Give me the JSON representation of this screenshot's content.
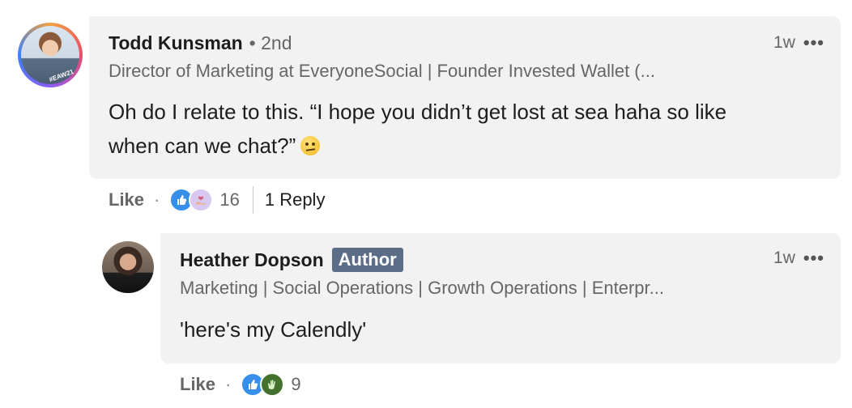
{
  "comment": {
    "author_name": "Todd Kunsman",
    "connection_degree": "• 2nd",
    "headline": "Director of Marketing at EveryoneSocial | Founder Invested Wallet (...",
    "time": "1w",
    "more_icon": "•••",
    "avatar_tag": "#EAW21",
    "text_line1": "Oh do I relate to this. “I hope you didn’t get lost at sea haha so like",
    "text_line2": "when can we chat?”",
    "emoji": "raised-eyebrow-face",
    "like_label": "Like",
    "separator": "·",
    "reactions": [
      "like",
      "support"
    ],
    "reaction_count": "16",
    "reply_label": "1 Reply"
  },
  "reply": {
    "author_name": "Heather Dopson",
    "author_badge": "Author",
    "headline": "Marketing | Social Operations | Growth Operations | Enterpr...",
    "time": "1w",
    "more_icon": "•••",
    "text": "'here's my Calendly'",
    "like_label": "Like",
    "separator": "·",
    "reactions": [
      "like",
      "celebrate"
    ],
    "reaction_count": "9"
  },
  "colors": {
    "bubble_bg": "#f2f2f2",
    "author_badge_bg": "#5c6e87",
    "like_reaction": "#378fe9",
    "celebrate_reaction": "#44712e"
  }
}
